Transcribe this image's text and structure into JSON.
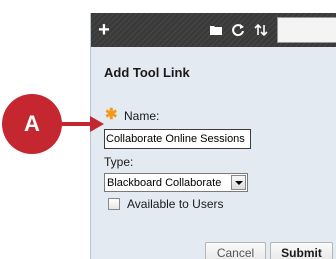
{
  "callout": {
    "letter": "A",
    "color": "#c4272f"
  },
  "toolbar": {
    "add_icon": "plus-icon",
    "folder_icon": "folder-icon",
    "refresh_icon": "refresh-icon",
    "sort_icon": "sort-icon"
  },
  "form": {
    "heading": "Add Tool Link",
    "name_label": "Name:",
    "name_value": "Collaborate Online Sessions",
    "type_label": "Type:",
    "type_value": "Blackboard Collaborate",
    "available_label": "Available to Users",
    "available_checked": false
  },
  "buttons": {
    "cancel": "Cancel",
    "submit": "Submit"
  }
}
